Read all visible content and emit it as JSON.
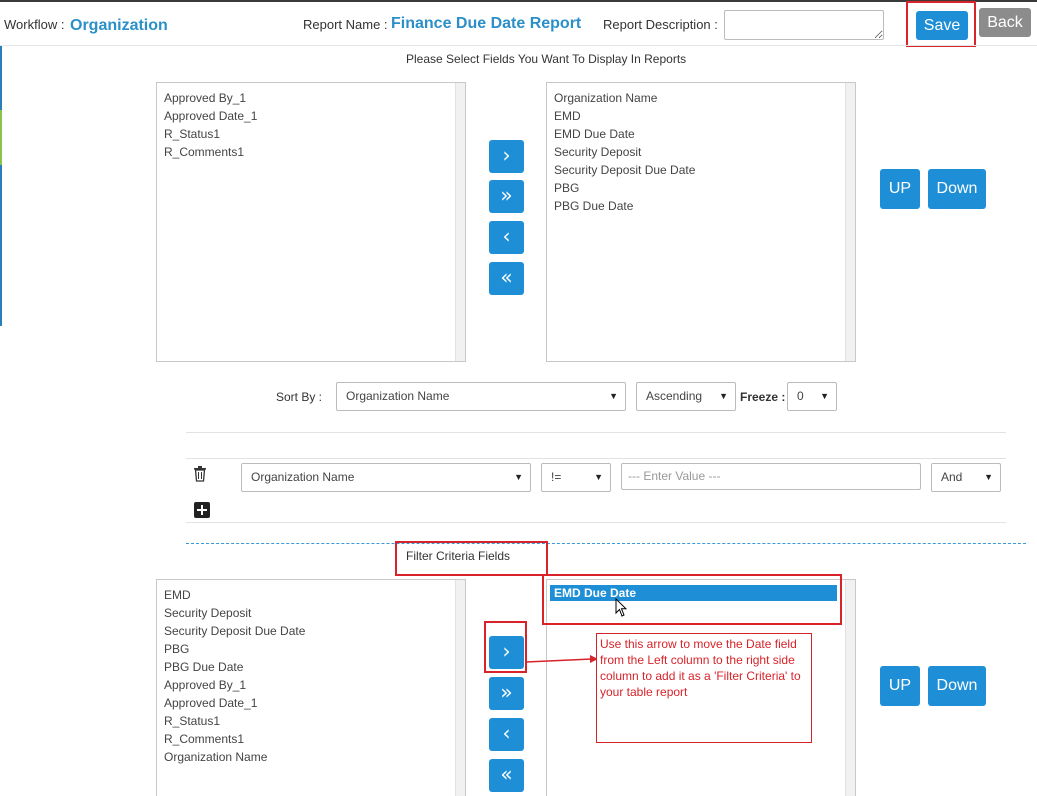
{
  "header": {
    "workflow_label": "Workflow :",
    "workflow_value": "Organization",
    "report_name_label": "Report Name :",
    "report_name_value": "Finance Due Date Report",
    "report_desc_label": "Report Description :",
    "report_desc_value": "",
    "save_label": "Save",
    "back_label": "Back"
  },
  "display_section": {
    "title": "Please Select Fields You Want To Display In Reports",
    "available_fields": [
      "Approved By_1",
      "Approved Date_1",
      "R_Status1",
      "R_Comments1"
    ],
    "selected_fields": [
      "Organization Name",
      "EMD",
      "EMD Due Date",
      "Security Deposit",
      "Security Deposit Due Date",
      "PBG",
      "PBG Due Date"
    ],
    "up_label": "UP",
    "down_label": "Down"
  },
  "arrows": {
    "move_right": "›",
    "move_all_right": "»",
    "move_left": "‹",
    "move_all_left": "«"
  },
  "sort": {
    "sort_by_label": "Sort By :",
    "sort_field": "Organization Name",
    "sort_order": "Ascending",
    "freeze_label": "Freeze :",
    "freeze_value": "0"
  },
  "filter_row": {
    "field": "Organization Name",
    "operator": "!=",
    "value_placeholder": "--- Enter Value ---",
    "conjunction": "And"
  },
  "filter_section": {
    "title": "Filter Criteria Fields",
    "available_fields": [
      "EMD",
      "Security Deposit",
      "Security Deposit Due Date",
      "PBG",
      "PBG Due Date",
      "Approved By_1",
      "Approved Date_1",
      "R_Status1",
      "R_Comments1",
      "Organization Name"
    ],
    "selected_fields": [
      "EMD Due Date"
    ],
    "up_label": "UP",
    "down_label": "Down"
  },
  "annotation": {
    "text": "Use this arrow to move the Date field from the Left column to the right side column to add it as a 'Filter Criteria' to your table report"
  },
  "colors": {
    "accent": "#1e8fd6",
    "title_blue": "#2b8fc8",
    "highlight_red": "#d8232a"
  }
}
